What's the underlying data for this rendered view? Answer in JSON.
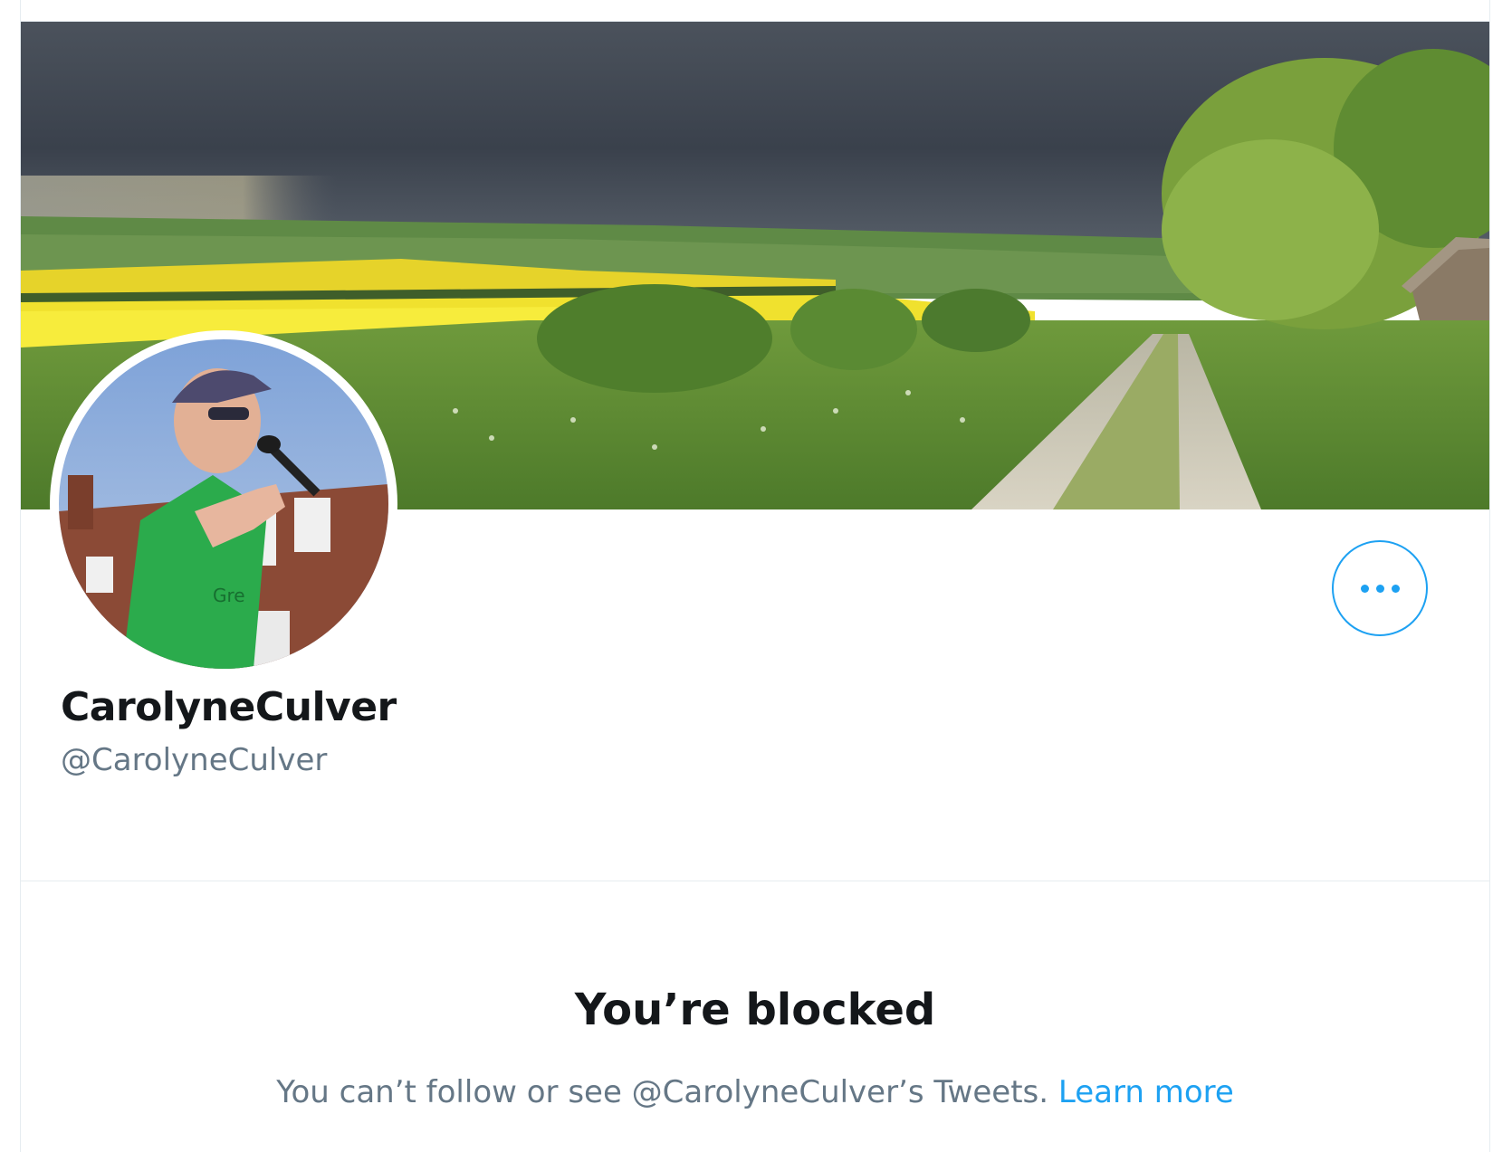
{
  "profile": {
    "display_name": "CarolyneCulver",
    "handle": "@CarolyneCulver"
  },
  "banner": {
    "description_icon": "landscape-banner-image"
  },
  "avatar": {
    "icon": "profile-photo",
    "shirt_text": "Gre"
  },
  "actions": {
    "more_icon": "more-options-icon"
  },
  "blocked": {
    "title": "You’re blocked",
    "message": "You can’t follow or see @CarolyneCulver’s Tweets.",
    "link": "Learn more"
  },
  "colors": {
    "accent": "#1da1f2",
    "text_primary": "#14171a",
    "text_secondary": "#657786",
    "border": "#e6ecf0"
  }
}
